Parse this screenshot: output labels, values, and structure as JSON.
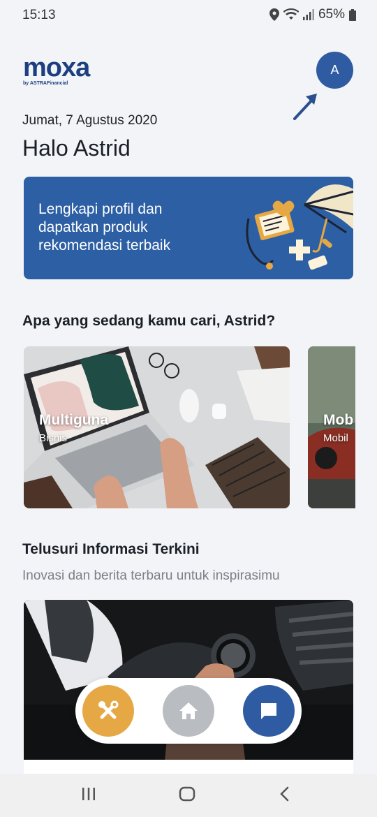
{
  "status": {
    "time": "15:13",
    "battery": "65%"
  },
  "header": {
    "logo": "moxa",
    "logo_sub": "by ASTRAFinancial",
    "avatar_initial": "A"
  },
  "home": {
    "date": "Jumat, 7 Agustus 2020",
    "greeting": "Halo Astrid"
  },
  "banner": {
    "text": "Lengkapi profil dan dapatkan produk rekomendasi terbaik"
  },
  "search_section": {
    "title": "Apa yang sedang kamu cari, Astrid?",
    "cards": [
      {
        "title": "Multiguna",
        "subtitle": "Bisnis"
      },
      {
        "title": "Mob",
        "subtitle": "Mobil"
      }
    ]
  },
  "news_section": {
    "title": "Telusuri Informasi Terkini",
    "subtitle": "Inovasi dan berita terbaru untuk inspirasimu"
  },
  "colors": {
    "primary": "#2f5ba2",
    "accent": "#e5a845",
    "background": "#f2f4f8"
  },
  "icons": [
    "location-icon",
    "wifi-icon",
    "signal-icon",
    "battery-icon",
    "tools-icon",
    "home-icon",
    "chat-icon",
    "recents-icon",
    "home-nav-icon",
    "back-icon"
  ]
}
